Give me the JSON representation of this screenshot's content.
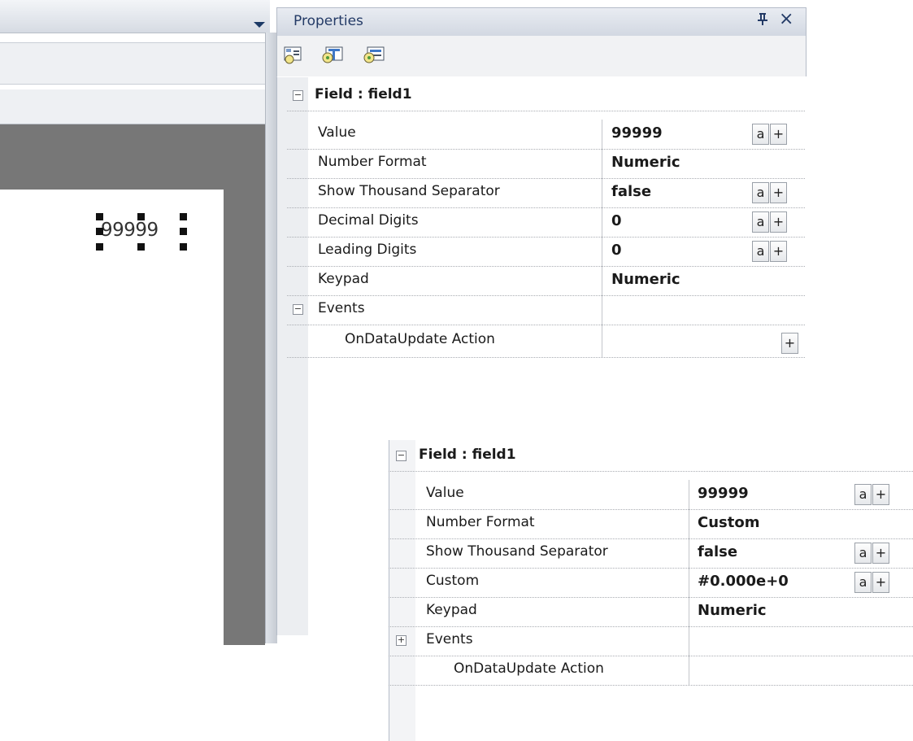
{
  "canvas": {
    "field_text": "99999"
  },
  "properties_panel": {
    "title": "Properties",
    "pin_glyph": "ᵖ",
    "close_glyph": "×",
    "toolbar_icons": [
      "categorized-view-icon",
      "alphabetical-view-icon",
      "property-pages-icon"
    ]
  },
  "grid1": {
    "section_label": "Field : field1",
    "rows": [
      {
        "name": "Value",
        "value": "99999",
        "buttons": [
          "a",
          "+"
        ]
      },
      {
        "name": "Number Format",
        "value": "Numeric",
        "buttons": []
      },
      {
        "name": "Show Thousand Separator",
        "value": "false",
        "buttons": [
          "a",
          "+"
        ]
      },
      {
        "name": "Decimal Digits",
        "value": "0",
        "buttons": [
          "a",
          "+"
        ]
      },
      {
        "name": "Leading Digits",
        "value": "0",
        "buttons": [
          "a",
          "+"
        ]
      },
      {
        "name": "Keypad",
        "value": "Numeric",
        "buttons": []
      }
    ],
    "events_label": "Events",
    "events_expander": "−",
    "event_rows": [
      {
        "name": "OnDataUpdate Action",
        "value": "",
        "buttons": [
          "+"
        ]
      }
    ]
  },
  "grid2": {
    "section_label": "Field : field1",
    "rows": [
      {
        "name": "Value",
        "value": "99999",
        "buttons": [
          "a",
          "+"
        ]
      },
      {
        "name": "Number Format",
        "value": "Custom",
        "buttons": []
      },
      {
        "name": "Show Thousand Separator",
        "value": "false",
        "buttons": [
          "a",
          "+"
        ]
      },
      {
        "name": "Custom",
        "value": "#0.000e+0",
        "buttons": [
          "a",
          "+"
        ]
      },
      {
        "name": "Keypad",
        "value": "Numeric",
        "buttons": []
      }
    ],
    "events_label": "Events",
    "events_expander": "+",
    "event_rows": [
      {
        "name": "OnDataUpdate Action",
        "value": "",
        "buttons": []
      }
    ]
  },
  "expander_collapse_glyph": "−",
  "button_labels": {
    "a": "a",
    "plus": "+"
  }
}
